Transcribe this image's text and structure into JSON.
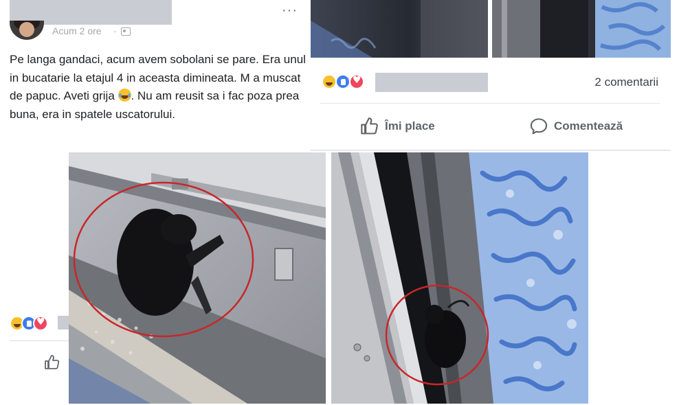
{
  "left_post": {
    "time": "Acum 2 ore",
    "separator": "·",
    "more_label": "···",
    "text_part1": "Pe langa gandaci, acum avem sobolani se pare. Era unul in bucatarie la etajul 4 in aceasta dimineata. M a muscat de papuc. Aveti grija ",
    "text_part2": ". Nu am reusit sa i fac poza prea buna, era in spatele uscatorului.",
    "reactions": [
      "haha",
      "like",
      "love"
    ]
  },
  "right_post": {
    "reactions": [
      "haha",
      "like",
      "love"
    ],
    "comments_count": "2 comentarii",
    "actions": {
      "like_label": "Îmi place",
      "comment_label": "Comentează"
    }
  },
  "photos": {
    "highlight_color": "#c8262a",
    "count": 2
  },
  "colors": {
    "text": "#1c1e21",
    "meta": "#a3a7ad",
    "action": "#5f636a",
    "redaction": "#c9ccd3",
    "like_blue": "#3b7cf1",
    "love_red": "#f0455d",
    "haha_yellow": "#f6c12a"
  },
  "icons": [
    "more-options-icon",
    "audience-icon",
    "haha-reaction-icon",
    "like-reaction-icon",
    "love-reaction-icon",
    "like-thumb-icon",
    "comment-bubble-icon"
  ]
}
